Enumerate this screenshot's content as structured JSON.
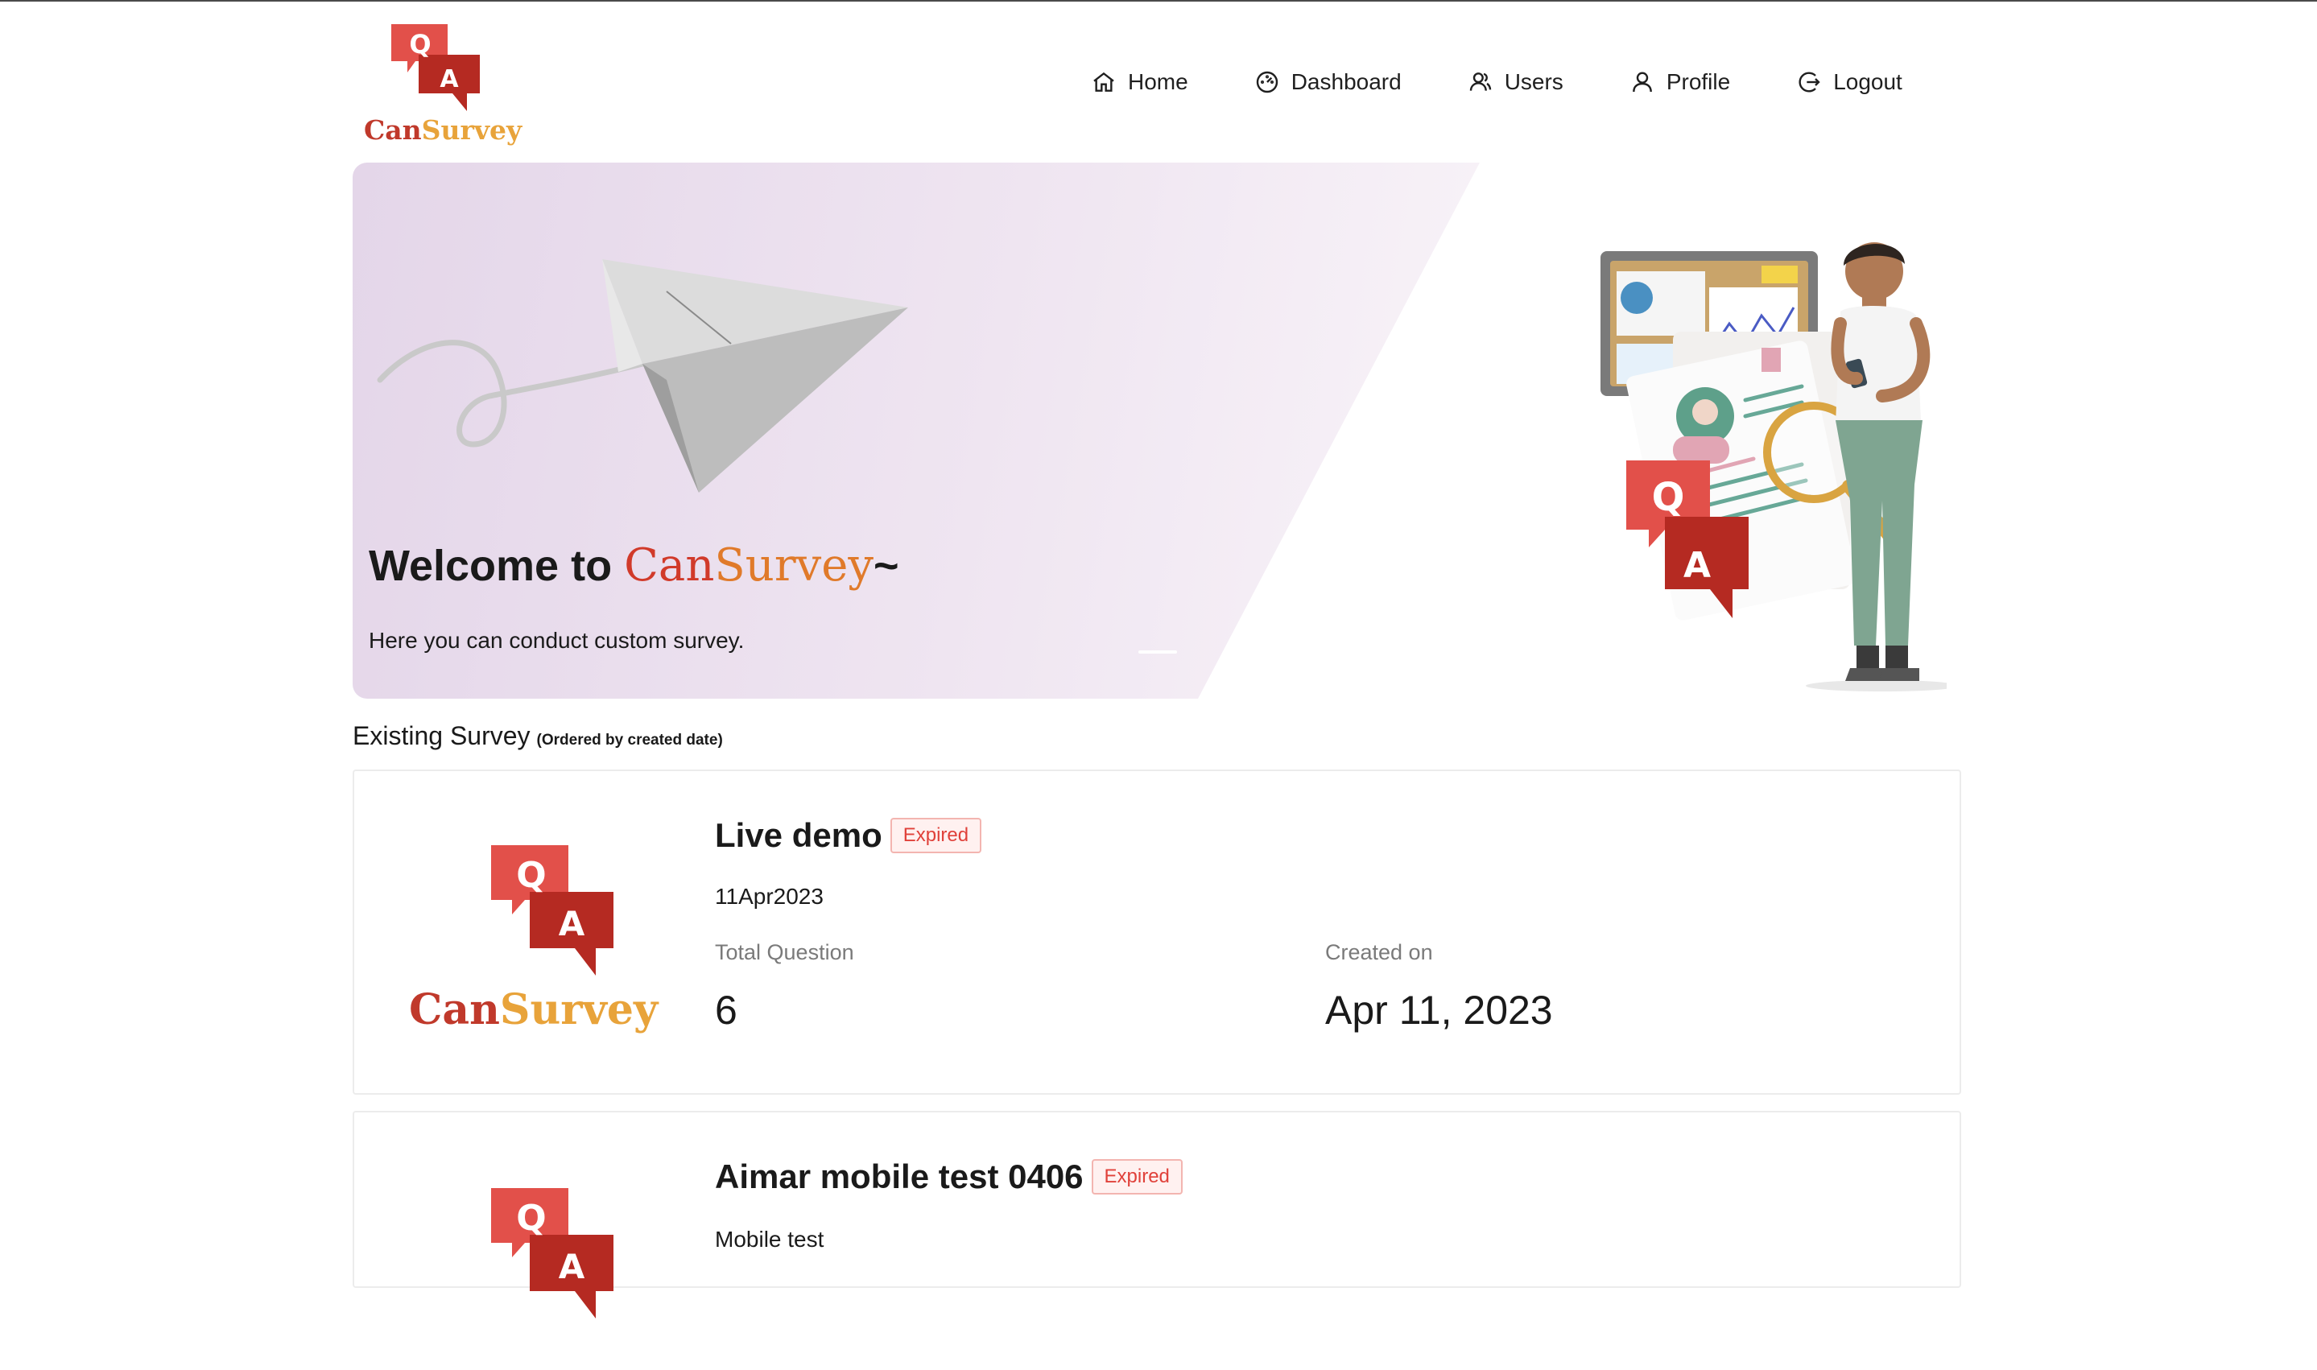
{
  "app": {
    "brand_can": "Can",
    "brand_survey": "Survey",
    "logo_q": "Q",
    "logo_a": "A"
  },
  "nav": {
    "home": "Home",
    "dashboard": "Dashboard",
    "users": "Users",
    "profile": "Profile",
    "logout": "Logout"
  },
  "hero": {
    "welcome_prefix": "Welcome to ",
    "brand_can": "Can",
    "brand_survey": "Survey",
    "welcome_suffix": "~",
    "subtitle": "Here you can conduct custom survey."
  },
  "section": {
    "title": "Existing Survey",
    "note": "(Ordered by created date)"
  },
  "surveys": [
    {
      "title": "Live demo",
      "status": "Expired",
      "description": "11Apr2023",
      "total_question_label": "Total Question",
      "total_question": "6",
      "created_label": "Created on",
      "created_on": "Apr 11, 2023"
    },
    {
      "title": "Aimar mobile test 0406",
      "status": "Expired",
      "description": "Mobile test"
    }
  ],
  "colors": {
    "brand_red": "#c0392b",
    "brand_gold": "#e8a33a",
    "badge_red": "#e0413a"
  }
}
